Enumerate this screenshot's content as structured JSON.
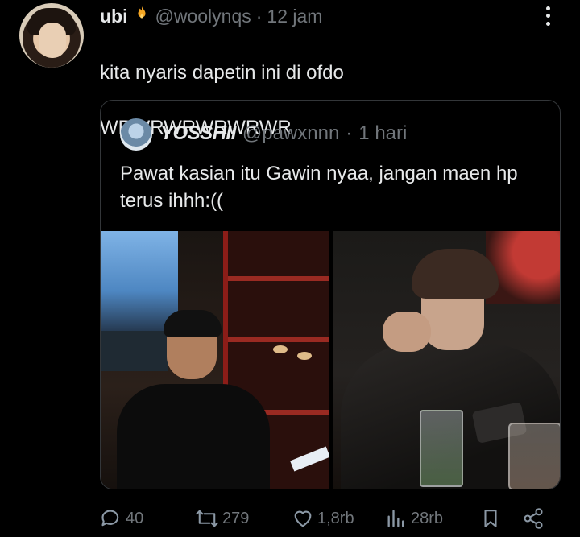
{
  "tweet": {
    "author_name": "ubi",
    "badge_icon": "fire-icon",
    "handle": "@woolynqs",
    "separator": "·",
    "time": "12 jam",
    "text_line1": "kita nyaris dapetin ini di ofdo",
    "text_line2": "WRWRWRWRWRWR"
  },
  "quote": {
    "author_name": "YOSSHII",
    "handle": "@pawxnnn",
    "separator": "·",
    "time": "1 hari",
    "text": "Pawat kasian itu Gawin nyaa, jangan maen hp terus ihhh:(("
  },
  "actions": {
    "replies": "40",
    "reposts": "279",
    "likes": "1,8rb",
    "views": "28rb"
  },
  "colors": {
    "background": "#000000",
    "primary_text": "#e7e9ea",
    "secondary_text": "#71767b",
    "border": "#333639",
    "badge": "#f5a623"
  }
}
